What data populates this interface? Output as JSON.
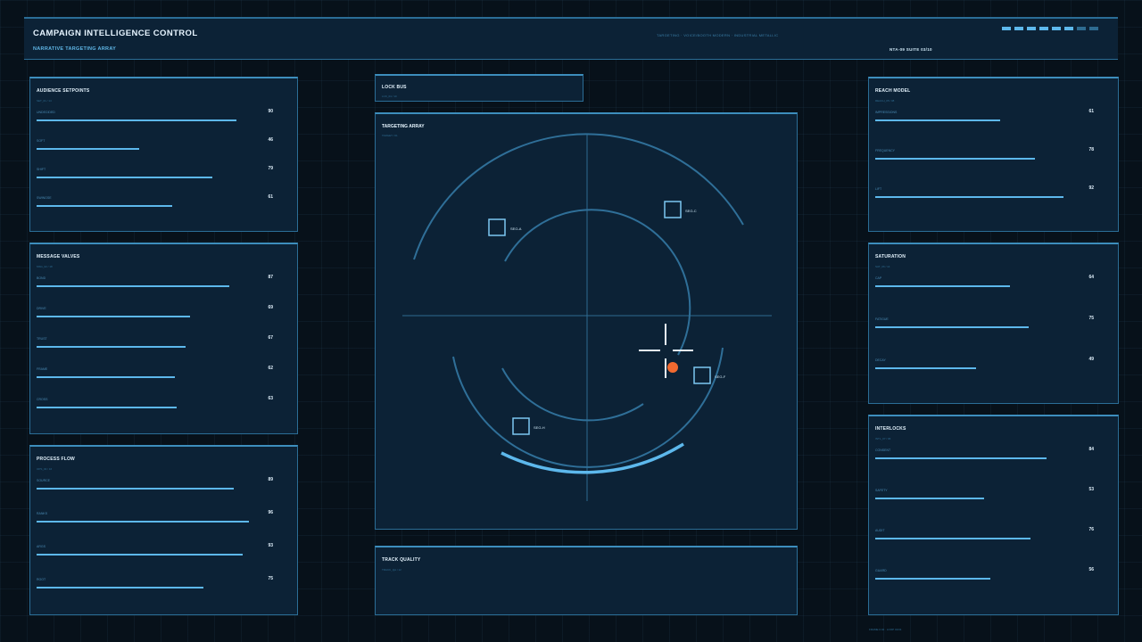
{
  "header": {
    "title": "CAMPAIGN INTELLIGENCE CONTROL",
    "subtitle": "NARRATIVE TARGETING ARRAY",
    "context": "TARGETING · VOICE/BOOTH MODERN · INDUSTRIAL METALLIC",
    "unit": "NTA-09  SUITE 03/10",
    "segments_active": 6,
    "segments_total": 8
  },
  "colors": {
    "accent": "#5db8ec",
    "panel": "#0c2236",
    "border": "#2b6d96",
    "alert": "#f26a30"
  },
  "audience_setpoints": {
    "title": "AUDIENCE SETPOINTS",
    "code": "SET_01 / 14",
    "items": [
      {
        "label": "UNDECIDED",
        "value": "90",
        "fill": 0.9
      },
      {
        "label": "SOFT",
        "value": "46",
        "fill": 0.46
      },
      {
        "label": "SHIFT",
        "value": "79",
        "fill": 0.79
      },
      {
        "label": "SWINGSE",
        "value": "61",
        "fill": 0.61
      }
    ]
  },
  "message_valves": {
    "title": "MESSAGE VALVES",
    "code": "MSG_02 / 18",
    "items": [
      {
        "label": "BOND",
        "value": "87",
        "fill": 0.87
      },
      {
        "label": "DRIVE",
        "value": "69",
        "fill": 0.69
      },
      {
        "label": "TRUST",
        "value": "67",
        "fill": 0.67
      },
      {
        "label": "FRAME",
        "value": "62",
        "fill": 0.62
      },
      {
        "label": "CROSS",
        "value": "63",
        "fill": 0.63
      }
    ]
  },
  "process_flow": {
    "title": "PROCESS FLOW",
    "code": "OPS_03 / 16",
    "items": [
      {
        "label": "SOURCE",
        "value": "89",
        "fill": 0.89
      },
      {
        "label": "RANKS",
        "value": "96",
        "fill": 0.96
      },
      {
        "label": "ARGS",
        "value": "93",
        "fill": 0.93
      },
      {
        "label": "ROOT",
        "value": "75",
        "fill": 0.75
      }
    ]
  },
  "lock_bus": {
    "title": "LOCK BUS",
    "code": "LCK_04 / 10"
  },
  "targeting_array": {
    "title": "TARGETING ARRAY",
    "code": "TARGET / 01",
    "targets": [
      {
        "id": "SEG-A"
      },
      {
        "id": "SEG-C"
      },
      {
        "id": "SEG-F"
      },
      {
        "id": "SEG-H"
      }
    ]
  },
  "track_quality": {
    "title": "TRACK QUALITY",
    "code": "TRACK_QA / 12"
  },
  "reach_model": {
    "title": "REACH MODEL",
    "code": "REACH_05 / 08",
    "items": [
      {
        "label": "IMPRESSIONS",
        "value": "61",
        "fill": 0.61
      },
      {
        "label": "FREQUENCY",
        "value": "78",
        "fill": 0.78
      },
      {
        "label": "LIFT",
        "value": "92",
        "fill": 0.92
      }
    ]
  },
  "saturation": {
    "title": "SATURATION",
    "code": "SAT_06 / 14",
    "items": [
      {
        "label": "CAP",
        "value": "64",
        "fill": 0.64
      },
      {
        "label": "FATIGUE",
        "value": "75",
        "fill": 0.75
      },
      {
        "label": "DECAY",
        "value": "49",
        "fill": 0.49
      }
    ]
  },
  "interlocks": {
    "title": "INTERLOCKS",
    "code": "INTL_07 / 06",
    "items": [
      {
        "label": "CONSENT",
        "value": "84",
        "fill": 0.84
      },
      {
        "label": "SAFETY",
        "value": "53",
        "fill": 0.53
      },
      {
        "label": "AUDIT",
        "value": "76",
        "fill": 0.76
      },
      {
        "label": "GUARD",
        "value": "56",
        "fill": 0.56
      }
    ]
  },
  "footer": "FRAME 0.04 · LOOP 01/01"
}
